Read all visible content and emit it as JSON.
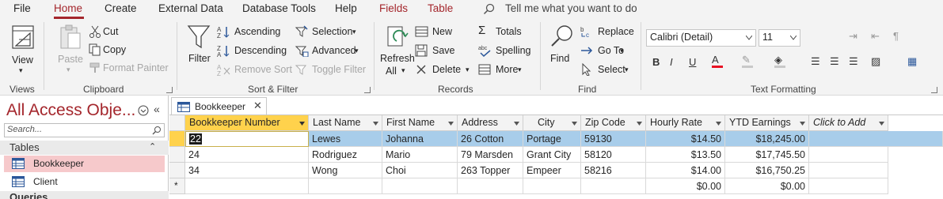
{
  "menu": {
    "items": [
      "File",
      "Home",
      "Create",
      "External Data",
      "Database Tools",
      "Help"
    ],
    "context_items": [
      "Fields",
      "Table"
    ],
    "tell_me": "Tell me what you want to do"
  },
  "ribbon": {
    "views": {
      "view_label": "View",
      "group": "Views"
    },
    "clipboard": {
      "paste": "Paste",
      "cut": "Cut",
      "copy": "Copy",
      "format_painter": "Format Painter",
      "group": "Clipboard"
    },
    "sort_filter": {
      "filter": "Filter",
      "ascending": "Ascending",
      "descending": "Descending",
      "remove_sort": "Remove Sort",
      "selection": "Selection",
      "advanced": "Advanced",
      "toggle_filter": "Toggle Filter",
      "group": "Sort & Filter"
    },
    "records": {
      "refresh": "Refresh",
      "refresh_all": "All",
      "new": "New",
      "save": "Save",
      "delete": "Delete",
      "totals": "Totals",
      "spelling": "Spelling",
      "more": "More",
      "group": "Records"
    },
    "find": {
      "find": "Find",
      "replace": "Replace",
      "go_to": "Go To",
      "select": "Select",
      "group": "Find"
    },
    "text_formatting": {
      "font": "Calibri (Detail)",
      "size": "11",
      "group": "Text Formatting"
    }
  },
  "nav": {
    "title": "All Access Obje...",
    "search_placeholder": "Search...",
    "section_tables": "Tables",
    "objects": [
      "Bookkeeper",
      "Client"
    ],
    "section_queries": "Queries"
  },
  "document": {
    "tab_label": "Bookkeeper",
    "columns": [
      "Bookkeeper Number",
      "Last Name",
      "First Name",
      "Address",
      "City",
      "Zip Code",
      "Hourly Rate",
      "YTD Earnings",
      "Click to Add"
    ],
    "rows": [
      [
        "22",
        "Lewes",
        "Johanna",
        "26 Cotton",
        "Portage",
        "59130",
        "$14.50",
        "$18,245.00"
      ],
      [
        "24",
        "Rodriguez",
        "Mario",
        "79 Marsden",
        "Grant City",
        "58120",
        "$13.50",
        "$17,745.50"
      ],
      [
        "34",
        "Wong",
        "Choi",
        "263 Topper",
        "Empeer",
        "58216",
        "$14.00",
        "$16,750.25"
      ]
    ],
    "new_row_marker": "*",
    "new_row_values": {
      "hourly_rate": "$0.00",
      "ytd_earnings": "$0.00"
    }
  },
  "colors": {
    "accent": "#a4262c",
    "selected_row": "#a8cdea",
    "selected_header": "#ffd24c",
    "nav_selected": "#f6c9cb"
  }
}
